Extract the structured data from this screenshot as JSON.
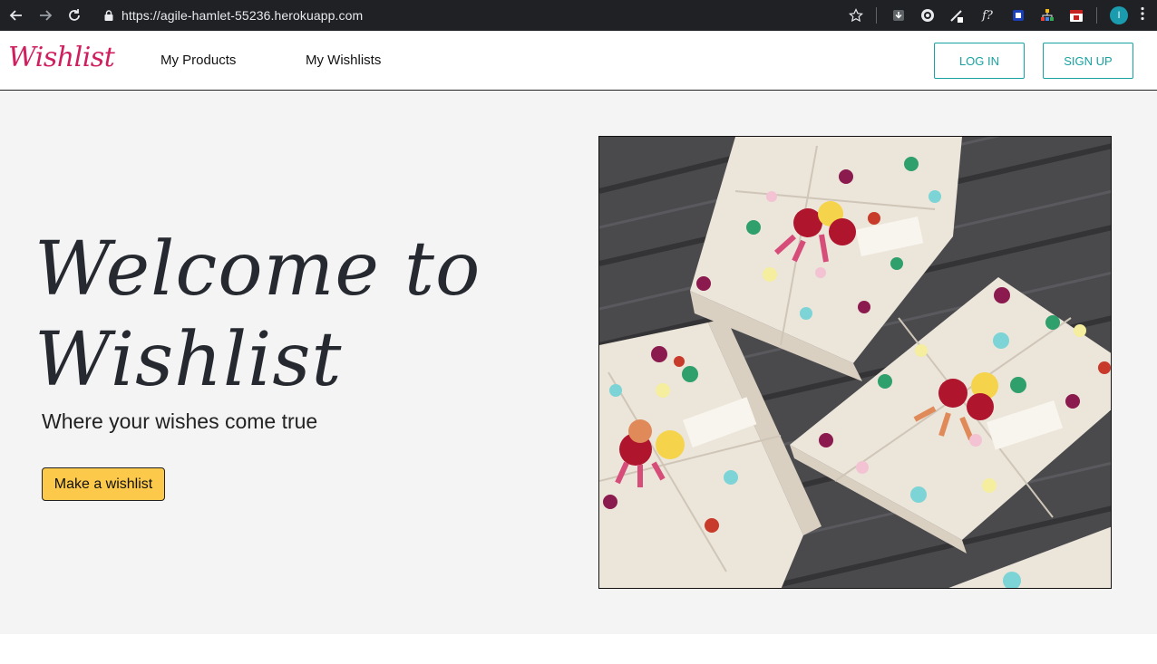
{
  "browser": {
    "url": "https://agile-hamlet-55236.herokuapp.com",
    "profile_initial": "I",
    "icons": [
      "back-arrow-icon",
      "forward-arrow-icon",
      "reload-icon",
      "lock-icon",
      "star-icon",
      "download-icon",
      "extension-icon",
      "pen-icon",
      "function-icon",
      "square-icon",
      "puzzle-icon",
      "calendar-icon",
      "menu-kebab-icon"
    ],
    "ext_function_label": "f?"
  },
  "navbar": {
    "brand": "Wishlist",
    "links": [
      "My Products",
      "My Wishlists"
    ],
    "login_label": "LOG IN",
    "signup_label": "SIGN UP",
    "accent_color": "#17a2a0",
    "brand_color": "#d01f5f"
  },
  "hero": {
    "title": "Welcome to Wishlist",
    "subtitle": "Where your wishes come true",
    "cta_label": "Make a wishlist",
    "cta_color": "#fcc94a"
  }
}
